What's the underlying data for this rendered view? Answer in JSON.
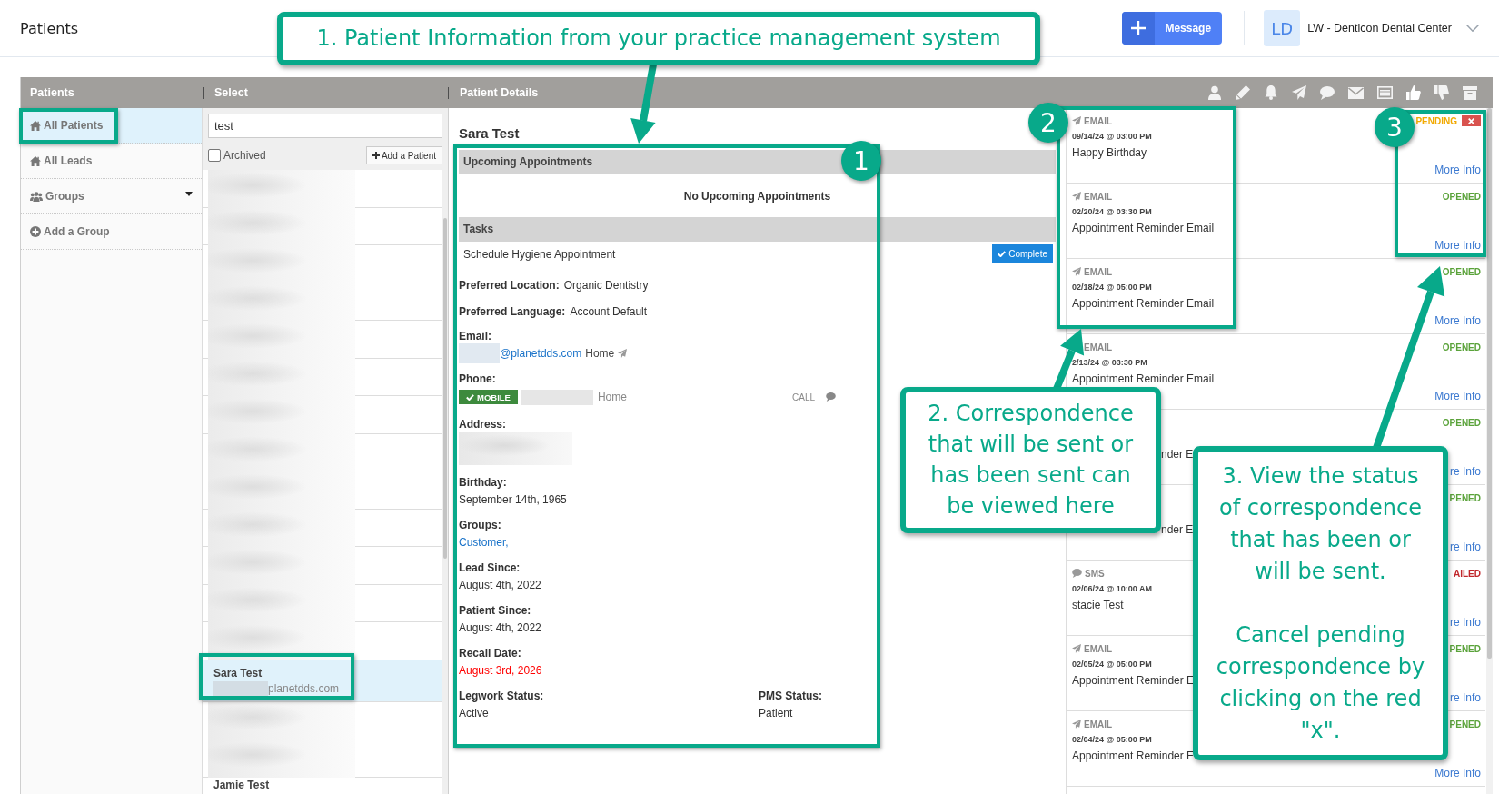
{
  "header": {
    "title": "Patients",
    "message_button": "Message",
    "account": {
      "initials": "LD",
      "name": "LW - Denticon Dental Center"
    }
  },
  "panel_headers": [
    "Patients",
    "Select",
    "Patient Details"
  ],
  "sidebar": {
    "items": [
      {
        "label": "All Patients",
        "kind": "list",
        "selected": true
      },
      {
        "label": "All Leads",
        "kind": "list",
        "selected": false
      },
      {
        "label": "Groups",
        "kind": "folder",
        "selected": false
      },
      {
        "label": "Add a Group",
        "kind": "action",
        "selected": false
      }
    ]
  },
  "select": {
    "search": "test",
    "archived": {
      "label": "Archived",
      "checked": false
    },
    "add_button": "Add a Patient",
    "patients": [
      {
        "redacted": true,
        "selected": false
      },
      {
        "redacted": true,
        "selected": false
      },
      {
        "redacted": true,
        "selected": false
      },
      {
        "redacted": true,
        "selected": false
      },
      {
        "redacted": true,
        "selected": false
      },
      {
        "redacted": true,
        "selected": false
      },
      {
        "redacted": true,
        "selected": false
      },
      {
        "redacted": true,
        "selected": false
      },
      {
        "redacted": true,
        "selected": false
      },
      {
        "redacted": true,
        "selected": false
      },
      {
        "redacted": true,
        "selected": false
      },
      {
        "redacted": true,
        "selected": false
      },
      {
        "redacted": true,
        "selected": false
      },
      {
        "name": "Sara Test",
        "email": "planetdds.com",
        "email_masked": true,
        "redacted": false,
        "selected": true
      },
      {
        "redacted": true,
        "selected": false
      },
      {
        "redacted": true,
        "selected": false
      },
      {
        "name": "Jamie Test",
        "redacted": false,
        "selected": false
      }
    ]
  },
  "details": {
    "name": "Sara Test",
    "sections": [
      {
        "title": "Upcoming Appointments",
        "empty_text": "No Upcoming Appointments"
      },
      {
        "title": "Tasks",
        "tasks": [
          {
            "text": "Schedule Hygiene Appointment",
            "button": "Complete"
          }
        ]
      }
    ],
    "fields": [
      {
        "kind": "inline",
        "label": "Preferred Location:",
        "value": "Organic Dentistry"
      },
      {
        "kind": "inline",
        "label": "Preferred Language:",
        "value": "Account Default"
      },
      {
        "kind": "email",
        "label": "Email:",
        "value": "@planetdds.com",
        "type": "Home"
      },
      {
        "kind": "phone",
        "label": "Phone:",
        "badge": "MOBILE",
        "type": "Home",
        "action": "CALL"
      },
      {
        "kind": "address",
        "label": "Address:"
      },
      {
        "kind": "stacked",
        "label": "Birthday:",
        "value": "September 14th, 1965"
      },
      {
        "kind": "link",
        "label": "Groups:",
        "value": "Customer,"
      },
      {
        "kind": "stacked",
        "label": "Lead Since:",
        "value": "August 4th, 2022"
      },
      {
        "kind": "stacked",
        "label": "Patient Since:",
        "value": "August 4th, 2022"
      },
      {
        "kind": "alert",
        "label": "Recall Date:",
        "value": "August 3rd, 2026"
      },
      {
        "kind": "pair",
        "items": [
          {
            "label": "Legwork Status:",
            "value": "Active"
          },
          {
            "label": "PMS Status:",
            "value": "Patient"
          }
        ]
      }
    ]
  },
  "correspondence": [
    {
      "kind": "email",
      "type": "EMAIL",
      "date": "09/14/24 @ 03:00 PM",
      "subject": "Happy Birthday",
      "status": "PENDING",
      "color": "#f2a900",
      "cancellable": true,
      "more": "More Info"
    },
    {
      "kind": "email",
      "type": "EMAIL",
      "date": "02/20/24 @ 03:30 PM",
      "subject": "Appointment Reminder Email",
      "status": "OPENED",
      "color": "#5ba33b",
      "cancellable": false,
      "more": "More Info"
    },
    {
      "kind": "email",
      "type": "EMAIL",
      "date": "02/18/24 @ 05:00 PM",
      "subject": "Appointment Reminder Email",
      "status": "OPENED",
      "color": "#5ba33b",
      "cancellable": false,
      "more": "More Info"
    },
    {
      "type": "EMAIL",
      "date": "2/13/24 @ 03:30 PM",
      "subject": "Appointment Reminder Email",
      "status": "OPENED",
      "color": "#5ba33b",
      "cancellable": false,
      "more": "More Info"
    },
    {
      "subject": "nder E",
      "status": "OPENED",
      "color": "#5ba33b",
      "cancellable": false,
      "more": "re Info"
    },
    {
      "subject": "nder E",
      "status": "PENED",
      "color": "#5ba33b",
      "cancellable": false,
      "more": "re Info"
    },
    {
      "kind": "sms",
      "type": "SMS",
      "date": "02/06/24 @ 10:00 AM",
      "subject": "stacie Test",
      "status": "AILED",
      "color": "#c0262b",
      "cancellable": false,
      "more": "re Info"
    },
    {
      "kind": "email",
      "type": "EMAIL",
      "date": "02/05/24 @ 05:00 PM",
      "subject": "Appointment Reminder E",
      "status": "PENED",
      "color": "#5ba33b",
      "cancellable": false,
      "more": "re Info"
    },
    {
      "kind": "email",
      "type": "EMAIL",
      "date": "02/04/24 @ 05:00 PM",
      "subject": "Appointment Reminder E",
      "status": "PENED",
      "color": "#5ba33b",
      "cancellable": false,
      "more": "More Info"
    }
  ],
  "annotations": {
    "callouts": [
      {
        "paragraphs": [
          "1. Patient Information from your practice management system"
        ]
      },
      {
        "paragraphs": [
          "2. Correspondence that will be sent or has been sent can be viewed here"
        ]
      },
      {
        "paragraphs": [
          "3. View the status of correspondence that has been or will be sent.",
          "Cancel pending correspondence by clicking on the red \"x\"."
        ]
      }
    ],
    "badges": [
      "1",
      "2",
      "3"
    ]
  }
}
